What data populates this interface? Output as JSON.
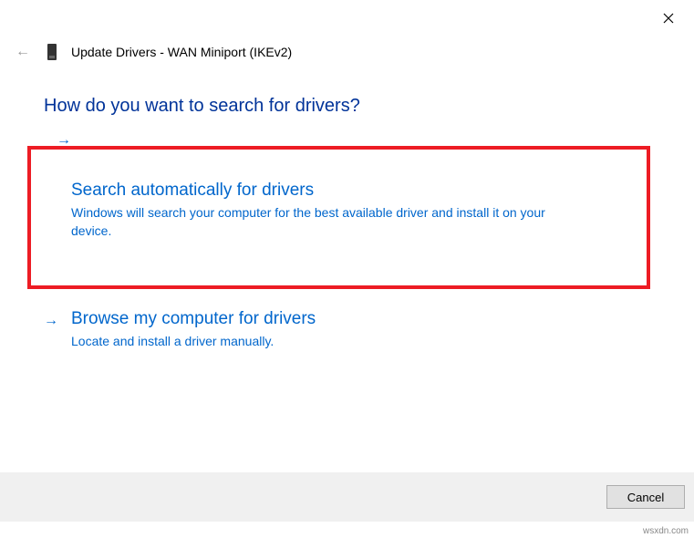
{
  "window": {
    "title": "Update Drivers - WAN Miniport (IKEv2)"
  },
  "heading": "How do you want to search for drivers?",
  "options": {
    "auto": {
      "title": "Search automatically for drivers",
      "desc": "Windows will search your computer for the best available driver and install it on your device."
    },
    "browse": {
      "title": "Browse my computer for drivers",
      "desc": "Locate and install a driver manually."
    }
  },
  "footer": {
    "cancel": "Cancel"
  },
  "watermark": "wsxdn.com"
}
